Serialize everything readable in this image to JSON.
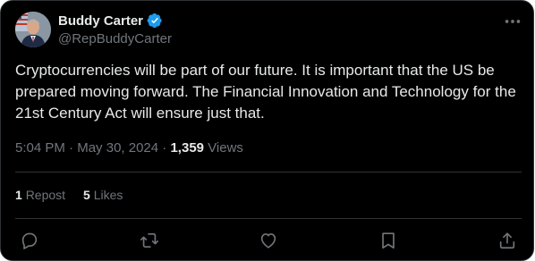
{
  "author": {
    "name": "Buddy Carter",
    "handle": "@RepBuddyCarter",
    "verified_color": "#1d9bf0"
  },
  "tweet": {
    "text": "Cryptocurrencies will be part of our future. It is important that the US be prepared moving forward. The Financial Innovation and Technology for the 21st Century Act will ensure just that.",
    "time": "5:04 PM",
    "date": "May 30, 2024",
    "separator": "·",
    "views_count": "1,359",
    "views_label": "Views"
  },
  "stats": {
    "reposts_count": "1",
    "reposts_label": "Repost",
    "likes_count": "5",
    "likes_label": "Likes"
  },
  "icons": {
    "more": "more-horizontal-icon",
    "reply": "reply-icon",
    "repost": "repost-icon",
    "like": "heart-icon",
    "bookmark": "bookmark-icon",
    "share": "share-icon"
  },
  "colors": {
    "background": "#000000",
    "text": "#e7e9ea",
    "secondary": "#71767b",
    "border": "#2f3336"
  }
}
